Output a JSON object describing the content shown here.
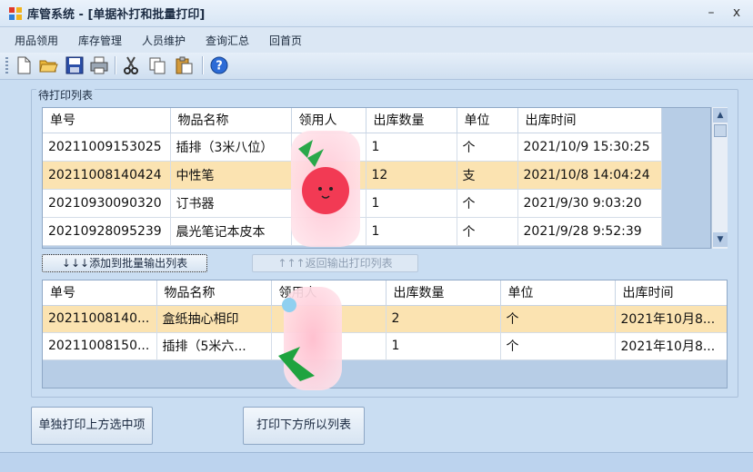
{
  "window": {
    "title": "库管系统 - [单据补打和批量打印]",
    "minimize_glyph": "–",
    "close_glyph": "x"
  },
  "menu": [
    "用品领用",
    "库存管理",
    "人员维护",
    "查询汇总",
    "回首页"
  ],
  "toolbar": [
    "new-icon",
    "open-icon",
    "save-icon",
    "print-icon",
    "cut-icon",
    "copy-icon",
    "paste-icon",
    "help-icon"
  ],
  "group_title": "待打印列表",
  "top_grid": {
    "columns": [
      "单号",
      "物品名称",
      "领用人",
      "出库数量",
      "单位",
      "出库时间"
    ],
    "rows": [
      {
        "id": "20211009153025",
        "item": "插排（3米八位）",
        "person": "",
        "qty": "1",
        "unit": "个",
        "time": "2021/10/9 15:30:25"
      },
      {
        "id": "20211008140424",
        "item": "中性笔",
        "person": "",
        "qty": "12",
        "unit": "支",
        "time": "2021/10/8 14:04:24"
      },
      {
        "id": "20210930090320",
        "item": "订书器",
        "person": "",
        "qty": "1",
        "unit": "个",
        "time": "2021/9/30 9:03:20"
      },
      {
        "id": "20210928095239",
        "item": "晨光笔记本皮本",
        "person": "",
        "qty": "1",
        "unit": "个",
        "time": "2021/9/28 9:52:39"
      }
    ],
    "selected_row": 1
  },
  "buttons": {
    "add": "↓↓↓添加到批量输出列表",
    "back": "↑↑↑返回输出打印列表",
    "print_selected": "单独打印上方选中项",
    "print_all": "打印下方所以列表"
  },
  "bottom_grid": {
    "columns": [
      "单号",
      "物品名称",
      "领用人",
      "出库数量",
      "单位",
      "出库时间"
    ],
    "rows": [
      {
        "id": "20211008140...",
        "item": "盒纸抽心相印",
        "person": "",
        "qty": "2",
        "unit": "个",
        "time": "2021年10月8..."
      },
      {
        "id": "20211008150...",
        "item": "插排（5米六...",
        "person": "",
        "qty": "1",
        "unit": "个",
        "time": "2021年10月8..."
      }
    ],
    "selected_row": 0
  },
  "colors": {
    "selected_row": "#fbe3b1",
    "background": "#c9ddf2"
  }
}
